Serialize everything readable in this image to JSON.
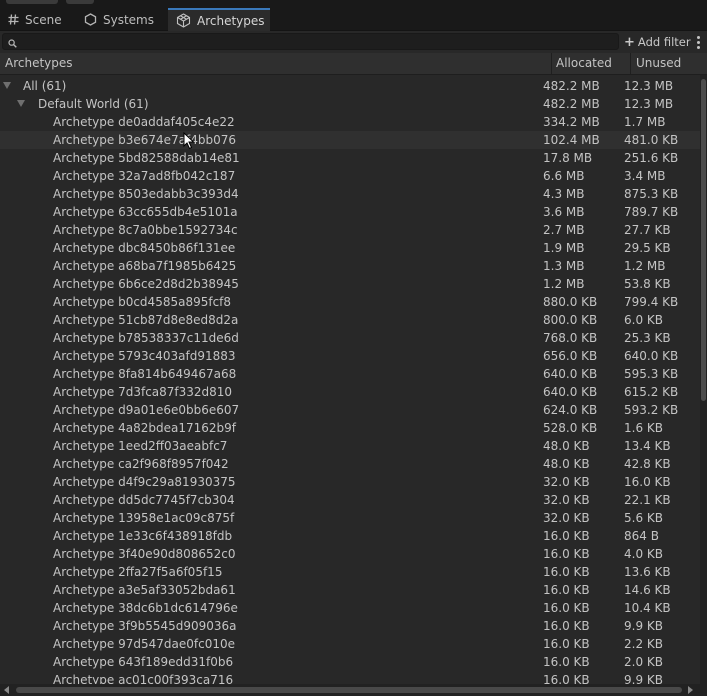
{
  "tabs": [
    {
      "label": "Scene",
      "icon": "hash-icon",
      "active": false
    },
    {
      "label": "Systems",
      "icon": "hexagon-icon",
      "active": false
    },
    {
      "label": "Archetypes",
      "icon": "archetype-cube-icon",
      "active": true
    }
  ],
  "search": {
    "placeholder": "",
    "value": ""
  },
  "add_filter_label": "Add filter",
  "columns": {
    "name": "Archetypes",
    "allocated": "Allocated",
    "unused": "Unused"
  },
  "tree": {
    "all": {
      "label": "All (61)",
      "allocated": "482.2 MB",
      "unused": "12.3 MB"
    },
    "world": {
      "label": "Default World (61)",
      "allocated": "482.2 MB",
      "unused": "12.3 MB"
    }
  },
  "archetypes": [
    {
      "name": "Archetype de0addaf405c4e22",
      "allocated": "334.2 MB",
      "unused": "1.7 MB"
    },
    {
      "name": "Archetype b3e674e7af4bb076",
      "allocated": "102.4 MB",
      "unused": "481.0 KB"
    },
    {
      "name": "Archetype 5bd82588dab14e81",
      "allocated": "17.8 MB",
      "unused": "251.6 KB"
    },
    {
      "name": "Archetype 32a7ad8fb042c187",
      "allocated": "6.6 MB",
      "unused": "3.4 MB"
    },
    {
      "name": "Archetype 8503edabb3c393d4",
      "allocated": "4.3 MB",
      "unused": "875.3 KB"
    },
    {
      "name": "Archetype 63cc655db4e5101a",
      "allocated": "3.6 MB",
      "unused": "789.7 KB"
    },
    {
      "name": "Archetype 8c7a0bbe1592734c",
      "allocated": "2.7 MB",
      "unused": "27.7 KB"
    },
    {
      "name": "Archetype dbc8450b86f131ee",
      "allocated": "1.9 MB",
      "unused": "29.5 KB"
    },
    {
      "name": "Archetype a68ba7f1985b6425",
      "allocated": "1.3 MB",
      "unused": "1.2 MB"
    },
    {
      "name": "Archetype 6b6ce2d8d2b38945",
      "allocated": "1.2 MB",
      "unused": "53.8 KB"
    },
    {
      "name": "Archetype b0cd4585a895fcf8",
      "allocated": "880.0 KB",
      "unused": "799.4 KB"
    },
    {
      "name": "Archetype 51cb87d8e8ed8d2a",
      "allocated": "800.0 KB",
      "unused": "6.0 KB"
    },
    {
      "name": "Archetype b78538337c11de6d",
      "allocated": "768.0 KB",
      "unused": "25.3 KB"
    },
    {
      "name": "Archetype 5793c403afd91883",
      "allocated": "656.0 KB",
      "unused": "640.0 KB"
    },
    {
      "name": "Archetype 8fa814b649467a68",
      "allocated": "640.0 KB",
      "unused": "595.3 KB"
    },
    {
      "name": "Archetype 7d3fca87f332d810",
      "allocated": "640.0 KB",
      "unused": "615.2 KB"
    },
    {
      "name": "Archetype d9a01e6e0bb6e607",
      "allocated": "624.0 KB",
      "unused": "593.2 KB"
    },
    {
      "name": "Archetype 4a82bdea17162b9f",
      "allocated": "528.0 KB",
      "unused": "1.6 KB"
    },
    {
      "name": "Archetype 1eed2ff03aeabfc7",
      "allocated": "48.0 KB",
      "unused": "13.4 KB"
    },
    {
      "name": "Archetype ca2f968f8957f042",
      "allocated": "48.0 KB",
      "unused": "42.8 KB"
    },
    {
      "name": "Archetype d4f9c29a81930375",
      "allocated": "32.0 KB",
      "unused": "16.0 KB"
    },
    {
      "name": "Archetype dd5dc7745f7cb304",
      "allocated": "32.0 KB",
      "unused": "22.1 KB"
    },
    {
      "name": "Archetype 13958e1ac09c875f",
      "allocated": "32.0 KB",
      "unused": "5.6 KB"
    },
    {
      "name": "Archetype 1e33c6f438918fdb",
      "allocated": "16.0 KB",
      "unused": "864 B"
    },
    {
      "name": "Archetype 3f40e90d808652c0",
      "allocated": "16.0 KB",
      "unused": "4.0 KB"
    },
    {
      "name": "Archetype 2ffa27f5a6f05f15",
      "allocated": "16.0 KB",
      "unused": "13.6 KB"
    },
    {
      "name": "Archetype a3e5af33052bda61",
      "allocated": "16.0 KB",
      "unused": "14.6 KB"
    },
    {
      "name": "Archetype 38dc6b1dc614796e",
      "allocated": "16.0 KB",
      "unused": "10.4 KB"
    },
    {
      "name": "Archetype 3f9b5545d909036a",
      "allocated": "16.0 KB",
      "unused": "9.9 KB"
    },
    {
      "name": "Archetype 97d547dae0fc010e",
      "allocated": "16.0 KB",
      "unused": "2.2 KB"
    },
    {
      "name": "Archetype 643f189edd31f0b6",
      "allocated": "16.0 KB",
      "unused": "2.0 KB"
    },
    {
      "name": "Archetype ac01c00f393ca716",
      "allocated": "16.0 KB",
      "unused": "9.9 KB"
    }
  ]
}
